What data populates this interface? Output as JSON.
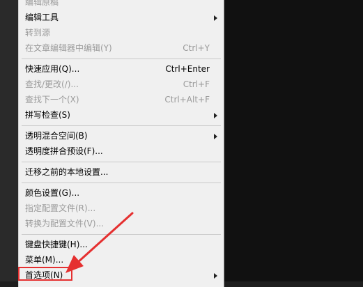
{
  "menu": {
    "items": [
      {
        "label": "编辑原稿",
        "shortcut": "",
        "disabled": true,
        "submenu": false
      },
      {
        "label": "编辑工具",
        "shortcut": "",
        "disabled": false,
        "submenu": true
      },
      {
        "label": "转到源",
        "shortcut": "",
        "disabled": true,
        "submenu": false
      },
      {
        "label": "在文章编辑器中编辑(Y)",
        "shortcut": "Ctrl+Y",
        "disabled": true,
        "submenu": false
      },
      {
        "label": "快速应用(Q)...",
        "shortcut": "Ctrl+Enter",
        "disabled": false,
        "submenu": false
      },
      {
        "label": "查找/更改(/)...",
        "shortcut": "Ctrl+F",
        "disabled": true,
        "submenu": false
      },
      {
        "label": "查找下一个(X)",
        "shortcut": "Ctrl+Alt+F",
        "disabled": true,
        "submenu": false
      },
      {
        "label": "拼写检查(S)",
        "shortcut": "",
        "disabled": false,
        "submenu": true
      },
      {
        "label": "透明混合空间(B)",
        "shortcut": "",
        "disabled": false,
        "submenu": true
      },
      {
        "label": "透明度拼合预设(F)...",
        "shortcut": "",
        "disabled": false,
        "submenu": false
      },
      {
        "label": "迁移之前的本地设置...",
        "shortcut": "",
        "disabled": false,
        "submenu": false
      },
      {
        "label": "颜色设置(G)...",
        "shortcut": "",
        "disabled": false,
        "submenu": false
      },
      {
        "label": "指定配置文件(R)...",
        "shortcut": "",
        "disabled": true,
        "submenu": false
      },
      {
        "label": "转换为配置文件(V)...",
        "shortcut": "",
        "disabled": true,
        "submenu": false
      },
      {
        "label": "键盘快捷键(H)...",
        "shortcut": "",
        "disabled": false,
        "submenu": false
      },
      {
        "label": "菜单(M)...",
        "shortcut": "",
        "disabled": false,
        "submenu": false
      },
      {
        "label": "首选项(N)",
        "shortcut": "",
        "disabled": false,
        "submenu": true
      }
    ]
  },
  "colors": {
    "menu_bg": "#f0f0f0",
    "disabled_text": "#9a9a9a",
    "annotation_red": "#e53030"
  },
  "annotation": {
    "highlighted_item": "首选项(N)",
    "icon": "arrow-annotation-icon"
  }
}
